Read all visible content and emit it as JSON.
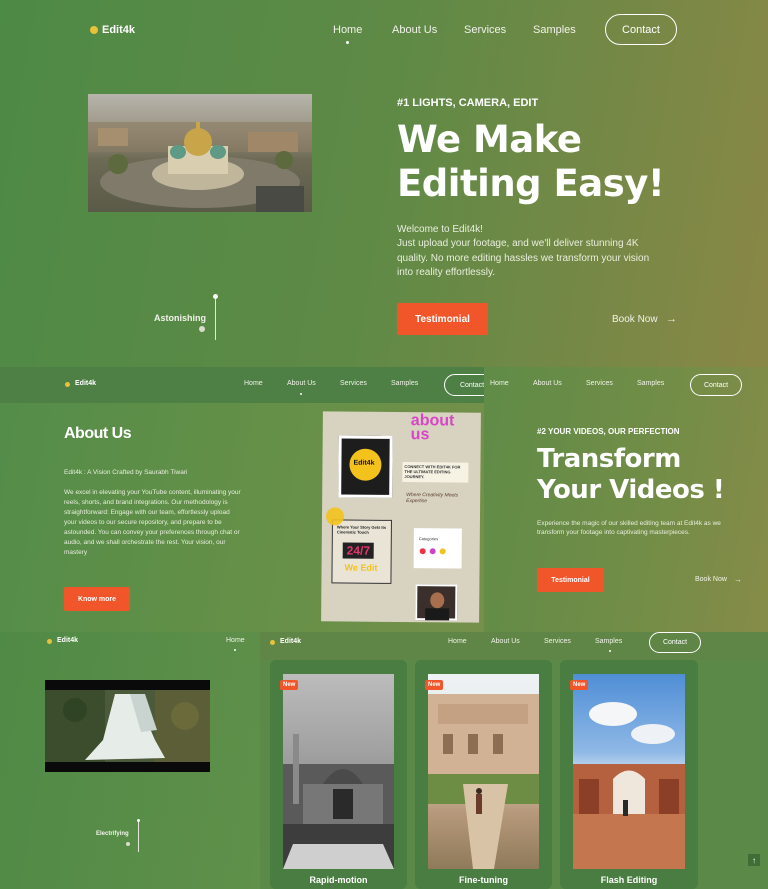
{
  "brand": {
    "name": "Edit4k",
    "dot_color": "#e8c23a"
  },
  "colors": {
    "accent": "#f0562a",
    "bg_green": "#4f8b47",
    "bg_olive": "#8a8a48"
  },
  "hero": {
    "nav": [
      "Home",
      "About Us",
      "Services",
      "Samples"
    ],
    "contact": "Contact",
    "kicker": "#1 LIGHTS, CAMERA, EDIT",
    "headline_1": "We Make",
    "headline_2": "Editing Easy!",
    "intro_1": "Welcome to Edit4k!",
    "intro_2": "Just upload your footage, and we'll deliver stunning 4K quality. No more editing hassles we transform your vision into reality effortlessly.",
    "cta": "Testimonial",
    "book": "Book Now",
    "arrow": "→",
    "scroll_label": "Astonishing"
  },
  "about": {
    "nav": [
      "Home",
      "About Us",
      "Services",
      "Samples"
    ],
    "contact": "Contact",
    "title": "About Us",
    "subtitle": "Edit4k : A Vision Crafted by Saurabh Tiwari",
    "paragraph": "We excel in elevating your YouTube content, illuminating your reels, shorts, and brand integrations. Our methodology is straightforward: Engage with our team, effortlessly upload your videos to our secure repository, and prepare to be astounded. You can convey your preferences through chat or audio, and we shall orchestrate the rest. Your vision, our mastery",
    "cta": "Know more",
    "collage": {
      "title": "about us",
      "logo": "Edit4k",
      "connect": "CONNECT WITH EDIT4K FOR THE ULTIMATE EDITING JOURNEY.",
      "quote": "Where Creativity Meets Expertise",
      "story": "Where Your Story Gets Its Cinematic Touch",
      "hours": "24/7",
      "we_edit": "We Edit",
      "categories": "Categories"
    }
  },
  "transform": {
    "nav": [
      "Home",
      "About Us",
      "Services",
      "Samples"
    ],
    "contact": "Contact",
    "kicker": "#2 YOUR VIDEOS, OUR PERFECTION",
    "headline_1": "Transform",
    "headline_2": "Your Videos !",
    "paragraph": "Experience the magic of our skilled editing team at Edit4k as we transform your footage into captivating masterpieces.",
    "cta": "Testimonial",
    "book": "Book Now",
    "arrow": "→"
  },
  "video": {
    "nav": [
      "Home"
    ],
    "scroll_label": "Electrifying"
  },
  "samples": {
    "nav": [
      "Home",
      "About Us",
      "Services",
      "Samples"
    ],
    "contact": "Contact",
    "cards": [
      {
        "badge": "New",
        "title": "Rapid-motion"
      },
      {
        "badge": "New",
        "title": "Fine-tuning"
      },
      {
        "badge": "New",
        "title": "Flash Editing"
      }
    ],
    "back_to_top": "↑"
  }
}
